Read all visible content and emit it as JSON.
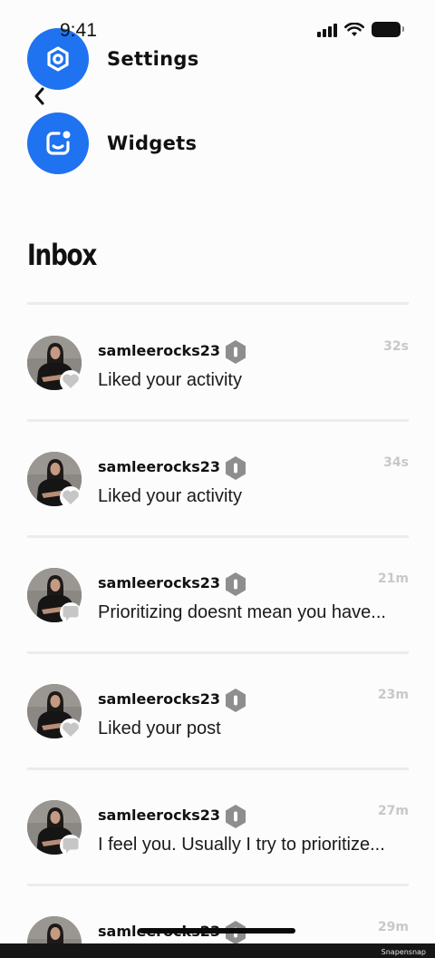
{
  "status_bar": {
    "time": "9:41",
    "icons": [
      "signal-icon",
      "wifi-icon",
      "battery-icon"
    ]
  },
  "nav": {
    "back_icon": "chevron-left-icon"
  },
  "menu": [
    {
      "label": "Settings",
      "icon": "settings-icon"
    },
    {
      "label": "Widgets",
      "icon": "widgets-icon"
    }
  ],
  "inbox": {
    "title": "Inbox",
    "items": [
      {
        "username": "samleerocks23",
        "time": "32s",
        "message": "Liked your activity",
        "badge": "heart-icon"
      },
      {
        "username": "samleerocks23",
        "time": "34s",
        "message": "Liked your activity",
        "badge": "heart-icon"
      },
      {
        "username": "samleerocks23",
        "time": "21m",
        "message": " Prioritizing doesnt mean you have...",
        "badge": "comment-icon"
      },
      {
        "username": "samleerocks23",
        "time": "23m",
        "message": "Liked your post",
        "badge": "heart-icon"
      },
      {
        "username": "samleerocks23",
        "time": "27m",
        "message": " I feel you. Usually I try to prioritize...",
        "badge": "comment-icon"
      },
      {
        "username": "samleerocks23",
        "time": "29m",
        "message": "",
        "badge": ""
      }
    ]
  },
  "footer": {
    "watermark": "Snapensnap"
  },
  "colors": {
    "accent": "#1f72f0",
    "time_gray": "#c8c8c8",
    "divider": "#ececec"
  }
}
